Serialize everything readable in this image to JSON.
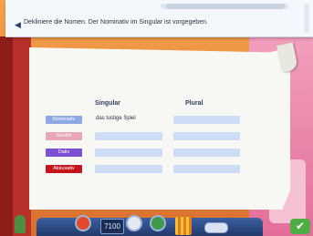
{
  "instruction": "Dekliniere die Nomen. Der Nominativ im Singular ist vorgegeben.",
  "table": {
    "headers": {
      "singular": "Singular",
      "plural": "Plural"
    },
    "rows": [
      {
        "case": "Nominativ",
        "color": "#8ea8e6",
        "singular": "das lustige Spiel",
        "plural": ""
      },
      {
        "case": "Genitiv",
        "color": "#e8a6b7",
        "singular": "",
        "plural": ""
      },
      {
        "case": "Dativ",
        "color": "#7b4fd0",
        "singular": "",
        "plural": ""
      },
      {
        "case": "Akkusativ",
        "color": "#c4151d",
        "singular": "",
        "plural": ""
      }
    ]
  },
  "toolbar": {
    "score": "7100"
  },
  "icons": {
    "speaker": "speaker-icon",
    "done": "checkmark-icon"
  }
}
